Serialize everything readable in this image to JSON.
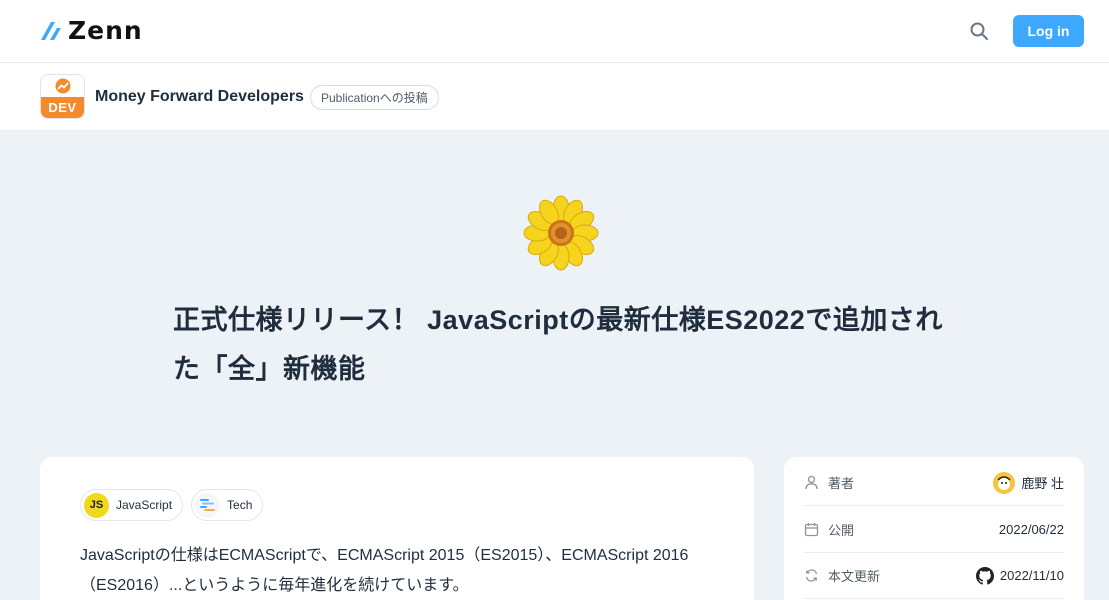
{
  "header": {
    "logo_text": "Zenn",
    "search_icon": "search-icon",
    "login_label": "Log in"
  },
  "publication": {
    "logo_label": "DEV",
    "name": "Money Forward Developers",
    "badge": "Publicationへの投稿"
  },
  "article": {
    "emoji": "sunflower",
    "title": "正式仕様リリース！ JavaScriptの最新仕様ES2022で追加された「全」新機能",
    "topics": [
      {
        "label": "JavaScript",
        "icon": "javascript-icon"
      },
      {
        "label": "Tech",
        "icon": "tech-icon"
      }
    ],
    "body": "JavaScriptの仕様はECMAScriptで、ECMAScript 2015（ES2015）、ECMAScript 2016（ES2016）...というように毎年進化を続けています。"
  },
  "sidebar": {
    "author_label": "著者",
    "author_name": "鹿野 壮",
    "published_label": "公開",
    "published_date": "2022/06/22",
    "updated_label": "本文更新",
    "updated_date": "2022/11/10"
  },
  "colors": {
    "accent": "#3ea8ff",
    "background": "#edf2f7",
    "publication_orange": "#f38a2c"
  }
}
